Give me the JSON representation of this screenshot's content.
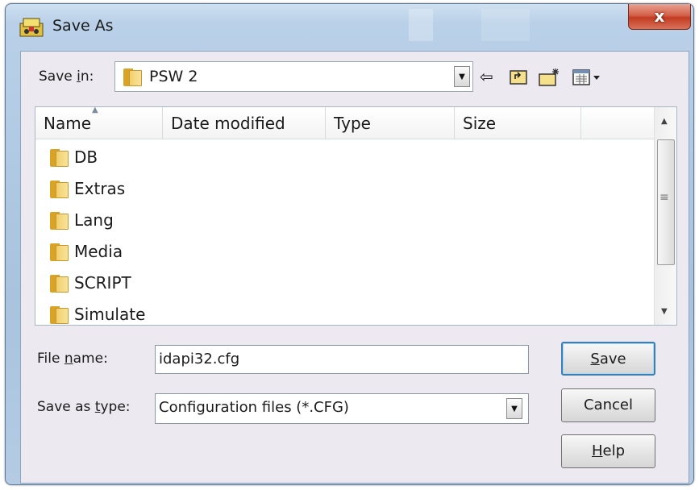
{
  "window": {
    "title": "Save As",
    "close_label": "x"
  },
  "toolbar": {
    "save_in_label": "Save in:",
    "save_in_value": "PSW 2",
    "icons": [
      "back-arrow-icon",
      "up-folder-icon",
      "new-folder-icon",
      "view-menu-icon"
    ]
  },
  "list": {
    "columns": [
      "Name",
      "Date modified",
      "Type",
      "Size"
    ],
    "items": [
      {
        "name": "DB"
      },
      {
        "name": "Extras"
      },
      {
        "name": "Lang"
      },
      {
        "name": "Media"
      },
      {
        "name": "SCRIPT"
      },
      {
        "name": "Simulate"
      }
    ]
  },
  "form": {
    "file_name_label": "File name:",
    "file_name_value": "idapi32.cfg",
    "save_as_type_label": "Save as type:",
    "save_as_type_value": "Configuration files (*.CFG)"
  },
  "buttons": {
    "save": "Save",
    "cancel": "Cancel",
    "help": "Help"
  },
  "colors": {
    "accent": "#3c7fb1",
    "close": "#c23c22",
    "folder": "#f2cf6d"
  }
}
